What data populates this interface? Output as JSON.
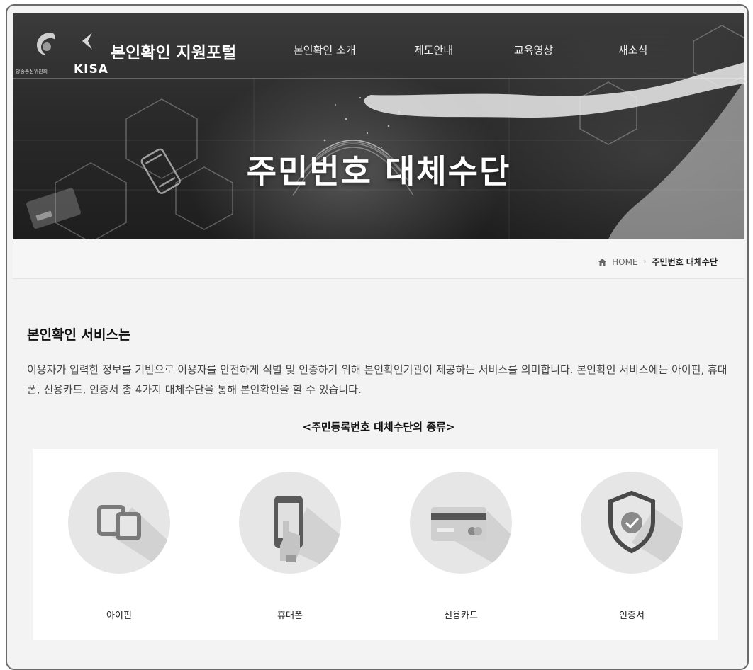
{
  "header": {
    "kcc_text": "방송통신위원회",
    "kisa_text": "KISA",
    "portal_title": "본인확인 지원포털",
    "nav": [
      "본인확인 소개",
      "제도안내",
      "교육영상",
      "새소식"
    ]
  },
  "hero": {
    "title": "주민번호 대체수단"
  },
  "breadcrumb": {
    "home": "HOME",
    "current": "주민번호 대체수단"
  },
  "content": {
    "section_title": "본인확인 서비스는",
    "description": "이용자가 입력한 정보를 기반으로 이용자를 안전하게 식별 및 인증하기 위해 본인확인기관이 제공하는 서비스를 의미합니다. 본인확인 서비스에는 아이핀, 휴대폰, 신용카드, 인증서 총 4가지 대체수단을 통해 본인확인을 할 수 있습니다.",
    "types_caption": "<주민등록번호 대체수단의 종류>",
    "types": [
      {
        "label": "아이핀",
        "icon": "ipin-icon"
      },
      {
        "label": "휴대폰",
        "icon": "mobile-phone-icon"
      },
      {
        "label": "신용카드",
        "icon": "credit-card-icon"
      },
      {
        "label": "인증서",
        "icon": "certificate-shield-icon"
      }
    ]
  }
}
